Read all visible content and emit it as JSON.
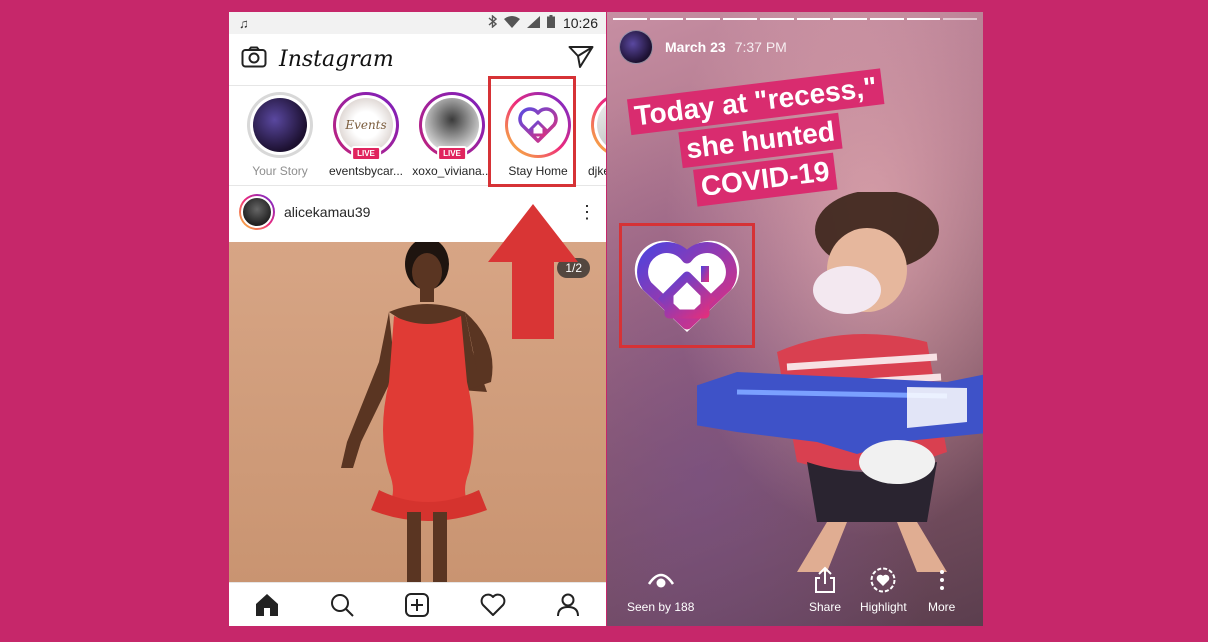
{
  "left_phone": {
    "status_bar": {
      "music_icon": "music-note-icon",
      "time": "10:26"
    },
    "header": {
      "app_title": "Instagram",
      "camera_icon": "camera-icon",
      "direct_icon": "paper-plane-icon"
    },
    "stories": [
      {
        "label": "Your Story",
        "live": false,
        "muted": true
      },
      {
        "label": "eventsbycar...",
        "live": true,
        "avatar_text": "Events"
      },
      {
        "label": "xoxo_viviana...",
        "live": true
      },
      {
        "label": "Stay Home",
        "live": false,
        "sticker": true
      },
      {
        "label": "djke",
        "live": false
      }
    ],
    "live_badge": "LIVE",
    "post": {
      "username": "alicekamau39",
      "counter": "1/2"
    },
    "bottom_nav": [
      "home-icon",
      "search-icon",
      "add-post-icon",
      "heart-icon",
      "profile-icon"
    ]
  },
  "right_phone": {
    "story_date": "March 23",
    "story_time": "7:37 PM",
    "caption_lines": [
      "Today at \"recess,\"",
      "she hunted",
      "COVID-19"
    ],
    "actions": {
      "seen_by": "Seen by 188",
      "share": "Share",
      "highlight": "Highlight",
      "more": "More"
    }
  },
  "colors": {
    "background": "#c6276a",
    "highlight_box": "#d63236",
    "caption_bg": "#d92c6f",
    "live_badge": "#e0245e"
  }
}
